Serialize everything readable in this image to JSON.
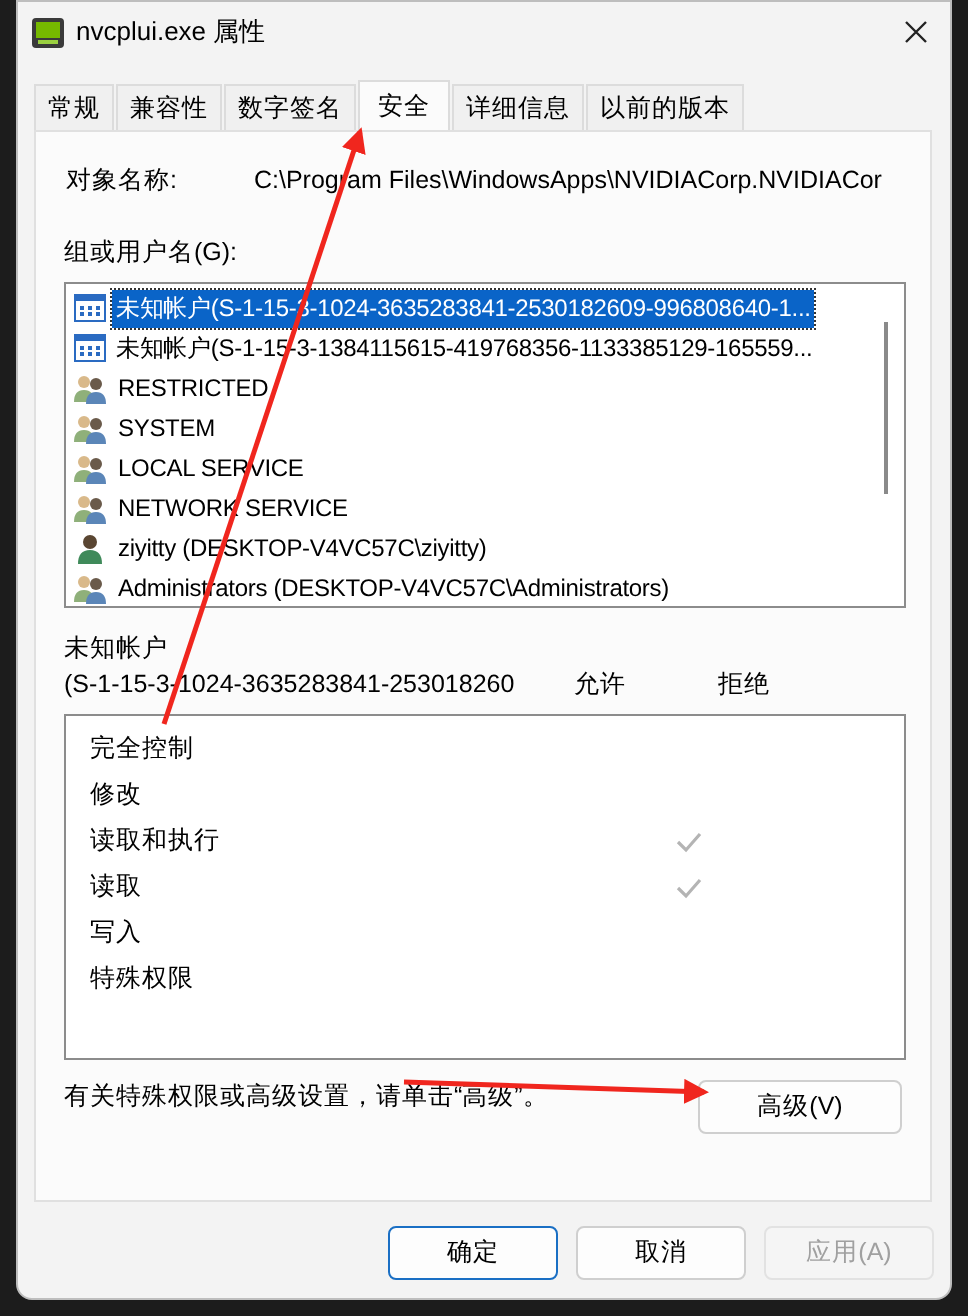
{
  "window": {
    "title": "nvcplui.exe 属性"
  },
  "tabs": [
    {
      "label": "常规",
      "selected": false
    },
    {
      "label": "兼容性",
      "selected": false
    },
    {
      "label": "数字签名",
      "selected": false
    },
    {
      "label": "安全",
      "selected": true
    },
    {
      "label": "详细信息",
      "selected": false
    },
    {
      "label": "以前的版本",
      "selected": false
    }
  ],
  "object_name": {
    "label": "对象名称:",
    "value": "C:\\Program Files\\WindowsApps\\NVIDIACorp.NVIDIACor"
  },
  "groups": {
    "label": "组或用户名(G):",
    "items": [
      {
        "name": "未知帐户(S-1-15-3-1024-3635283841-2530182609-996808640-1...",
        "kind": "unknown",
        "selected": true
      },
      {
        "name": "未知帐户(S-1-15-3-1384115615-419768356-1133385129-165559...",
        "kind": "unknown",
        "selected": false
      },
      {
        "name": "RESTRICTED",
        "kind": "group",
        "selected": false
      },
      {
        "name": "SYSTEM",
        "kind": "group",
        "selected": false
      },
      {
        "name": "LOCAL SERVICE",
        "kind": "group",
        "selected": false
      },
      {
        "name": "NETWORK SERVICE",
        "kind": "group",
        "selected": false
      },
      {
        "name": "ziyitty (DESKTOP-V4VC57C\\ziyitty)",
        "kind": "user",
        "selected": false
      },
      {
        "name": "Administrators (DESKTOP-V4VC57C\\Administrators)",
        "kind": "group",
        "selected": false
      }
    ]
  },
  "permissions": {
    "account": "未知帐户",
    "account_sid": "(S-1-15-3-1024-3635283841-253018260",
    "allow_header": "允许",
    "deny_header": "拒绝",
    "rows": [
      {
        "name": "完全控制",
        "allow": false,
        "deny": false
      },
      {
        "name": "修改",
        "allow": false,
        "deny": false
      },
      {
        "name": "读取和执行",
        "allow": true,
        "deny": false
      },
      {
        "name": "读取",
        "allow": true,
        "deny": false
      },
      {
        "name": "写入",
        "allow": false,
        "deny": false
      },
      {
        "name": "特殊权限",
        "allow": false,
        "deny": false
      }
    ]
  },
  "advanced": {
    "hint": "有关特殊权限或高级设置，请单击“高级”。",
    "button": "高级(V)"
  },
  "buttons": [
    {
      "label": "确定",
      "default": true,
      "disabled": false
    },
    {
      "label": "取消",
      "default": false,
      "disabled": false
    },
    {
      "label": "应用(A)",
      "default": false,
      "disabled": true
    }
  ]
}
